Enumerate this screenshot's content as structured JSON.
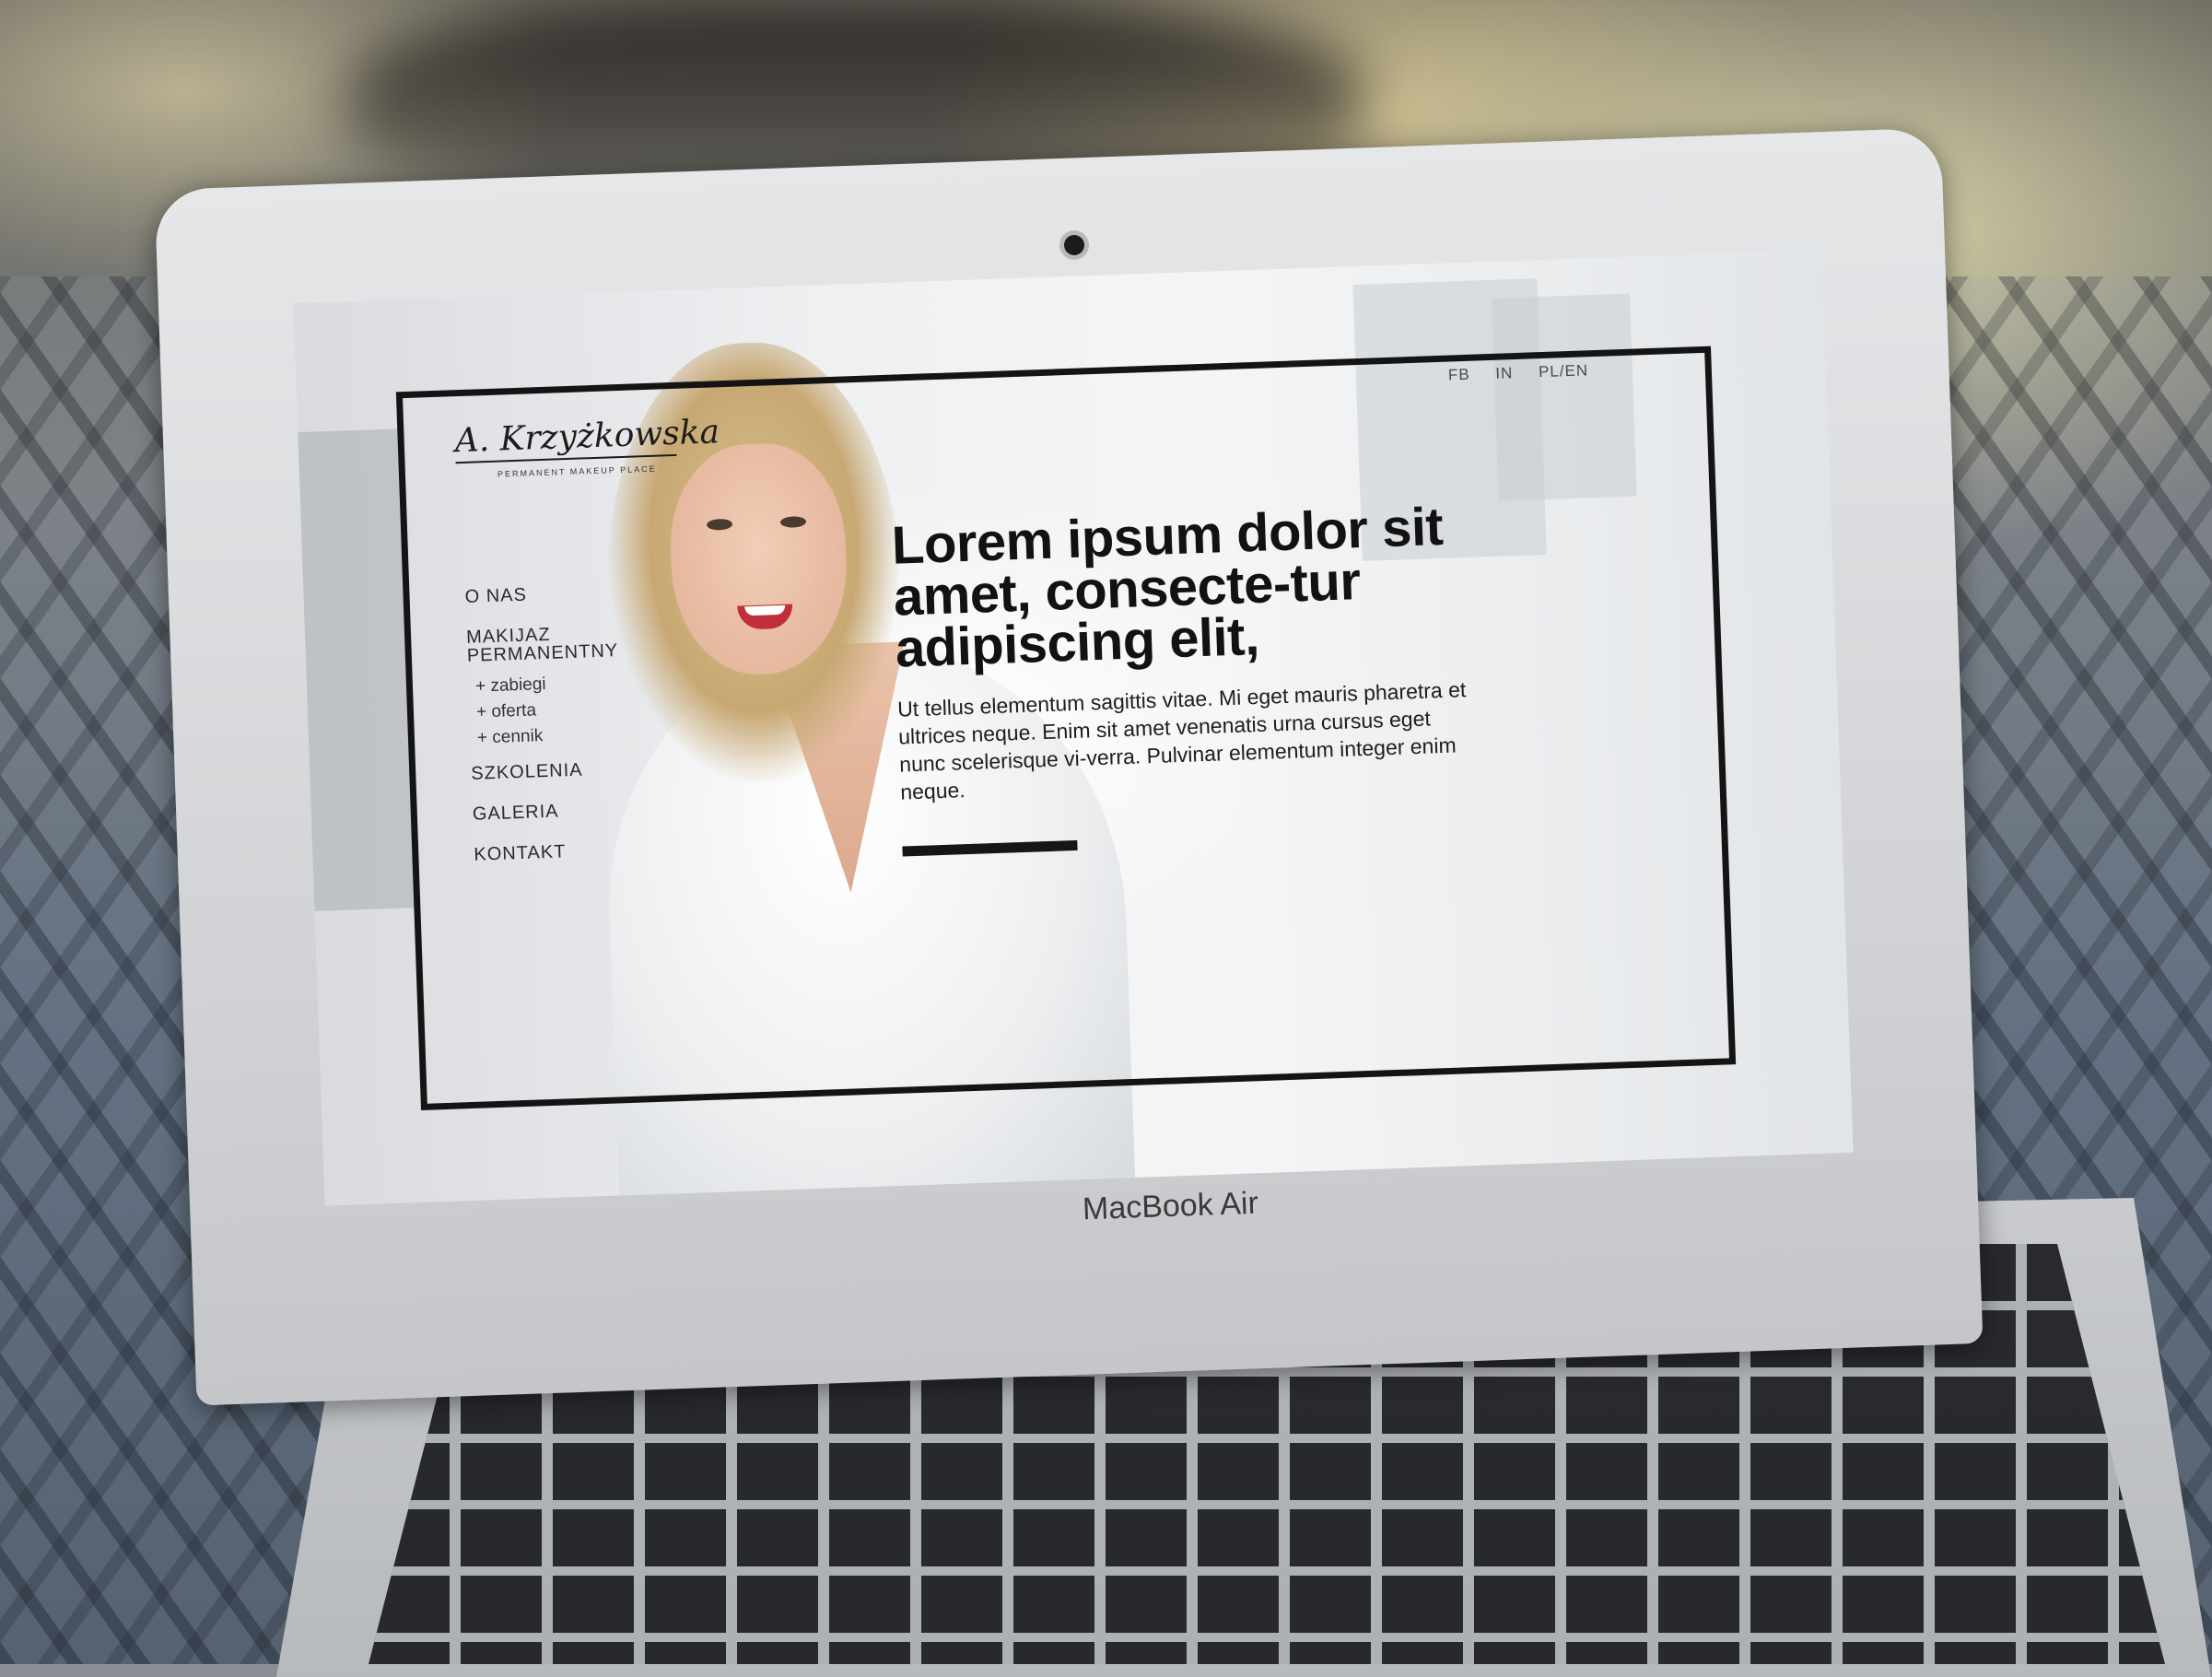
{
  "site": {
    "logo": {
      "signature": "A. Krzyżkowska",
      "tagline": "PERMANENT MAKEUP PLACE"
    },
    "top_links": [
      "FB",
      "IN",
      "PL/EN"
    ],
    "nav": {
      "o_nas": "O NAS",
      "makijaz": "MAKIJAZ PERMANENTNY",
      "sub": [
        "+ zabiegi",
        "+ oferta",
        "+ cennik"
      ],
      "szkolenia": "SZKOLENIA",
      "galeria": "GALERIA",
      "kontakt": "KONTAKT"
    },
    "hero": {
      "title": "Lorem ipsum dolor sit amet, consecte-tur adipiscing elit,",
      "text": "Ut tellus elementum sagittis vitae. Mi eget mauris pharetra et ultrices neque. Enim sit amet venenatis urna cursus eget nunc scelerisque vi-verra. Pulvinar elementum integer enim neque."
    }
  },
  "device": {
    "brand": "MacBook Air"
  },
  "colors": {
    "frame": "#141414",
    "text_dark": "#121212",
    "laptop_silver": "#d2d4d7"
  }
}
